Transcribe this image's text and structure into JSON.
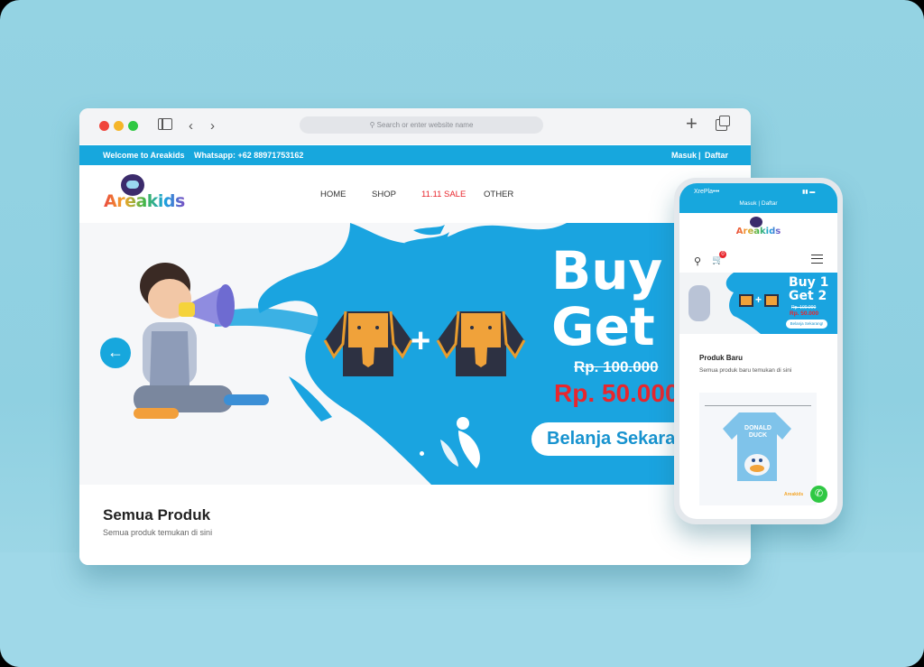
{
  "browser": {
    "address_placeholder": "Search or enter website name"
  },
  "site": {
    "welcome": "Welcome to Areakids",
    "whatsapp": "Whatsapp: +62 88971753162",
    "login": "Masuk",
    "separator": "|",
    "register": "Daftar",
    "logo": "Areakids",
    "nav": [
      "HOME",
      "SHOP",
      "11.11 SALE",
      "OTHER"
    ],
    "sale_color": "#e8262d",
    "brand_color": "#17a7dd"
  },
  "hero": {
    "buy": "Buy 1",
    "get": "Get 2",
    "old_price": "Rp. 100.000",
    "new_price": "Rp. 50.000",
    "cta": "Belanja Sekarang!",
    "plus": "+",
    "prev_arrow": "←"
  },
  "section": {
    "title": "Semua Produk",
    "subtitle": "Semua produk temukan di sini"
  },
  "phone": {
    "carrier": "XrePla•••",
    "login": "Masuk",
    "register": "Daftar",
    "logo": "Areakids",
    "cart_count": "0",
    "buy": "Buy 1",
    "get": "Get 2",
    "old_price": "Rp. 100.000",
    "new_price": "Rp. 50.000",
    "cta": "Belanja Sekarang!",
    "plus": "+",
    "section_title": "Produk Baru",
    "section_subtitle": "Semua produk baru temukan di sini",
    "shirt_text_1": "DONALD",
    "shirt_text_2": "DUCK",
    "mini_logo": "Areakids"
  }
}
